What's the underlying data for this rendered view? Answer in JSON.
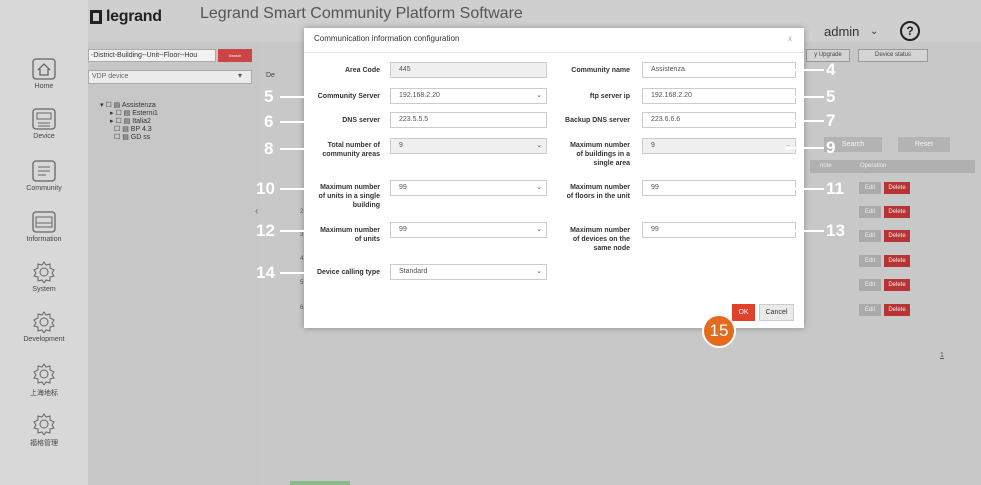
{
  "header": {
    "brand": "legrand",
    "app_title": "Legrand Smart Community Platform Software",
    "user": "admin",
    "help_label": "?"
  },
  "sidebar": {
    "items": [
      {
        "label": "Home",
        "icon": "home-icon"
      },
      {
        "label": "Device",
        "icon": "device-icon"
      },
      {
        "label": "Community",
        "icon": "community-icon"
      },
      {
        "label": "Information",
        "icon": "information-icon"
      },
      {
        "label": "System",
        "icon": "gear-icon"
      },
      {
        "label": "Development",
        "icon": "gear-icon"
      },
      {
        "label": "上海地标",
        "icon": "gear-icon"
      },
      {
        "label": "福格管理",
        "icon": "gear-icon"
      }
    ]
  },
  "tree_panel": {
    "location_value": "-District-Building--Unit--Floor--Hou",
    "search_label": "Search",
    "vdp_select": "VDP device",
    "nodes": [
      "Assistenza",
      "Esterni1",
      "Italia2",
      "BP 4.3",
      "GD ss"
    ]
  },
  "main": {
    "prefix_de": "De",
    "upgrade_button": "y Upgrade",
    "device_status_button": "Device status",
    "search_button": "Search",
    "reset_button": "Reset",
    "table_headers": {
      "note": "note",
      "operation": "Operation"
    },
    "row_edit": "Edit",
    "row_delete": "Delete",
    "row_numbers": [
      "2",
      "3",
      "4",
      "5",
      "6"
    ],
    "pager_number": "1",
    "nav_back": "‹"
  },
  "modal": {
    "title": "Communication information configuration",
    "close": "x",
    "fields": {
      "area_code": {
        "label": "Area Code",
        "value": "445"
      },
      "community_name": {
        "label": "Community name",
        "value": "Assistenza"
      },
      "community_server": {
        "label": "Community Server",
        "value": "192.168.2.20"
      },
      "ftp_server_ip": {
        "label": "ftp server ip",
        "value": "192.168.2.20"
      },
      "dns_server": {
        "label": "DNS server",
        "value": "223.5.5.5"
      },
      "backup_dns_server": {
        "label": "Backup DNS server",
        "value": "223.6.6.6"
      },
      "total_areas": {
        "label_1": "Total number of",
        "label_2": "community areas",
        "value": "9"
      },
      "max_buildings": {
        "label_1": "Maximum number",
        "label_2": "of buildings in a",
        "label_3": "single area",
        "value": "9"
      },
      "max_units_building": {
        "label_1": "Maximum number",
        "label_2": "of units in a single",
        "label_3": "building",
        "value": "99"
      },
      "max_floors": {
        "label_1": "Maximum number",
        "label_2": "of floors in the unit",
        "value": "99"
      },
      "max_units": {
        "label_1": "Maximum number",
        "label_2": "of units",
        "value": "99"
      },
      "max_devices": {
        "label_1": "Maximum number",
        "label_2": "of devices on the",
        "label_3": "same node",
        "value": "99"
      },
      "device_calling_type": {
        "label": "Device calling type",
        "value": "Standard"
      }
    },
    "ok_label": "OK",
    "cancel_label": "Cancel"
  },
  "callouts": [
    "4",
    "5",
    "5",
    "6",
    "7",
    "8",
    "9",
    "10",
    "11",
    "12",
    "13",
    "14",
    "15"
  ],
  "colors": {
    "accent": "#e0412a",
    "callout_badge": "#e46a1e",
    "delete": "#b83333"
  }
}
